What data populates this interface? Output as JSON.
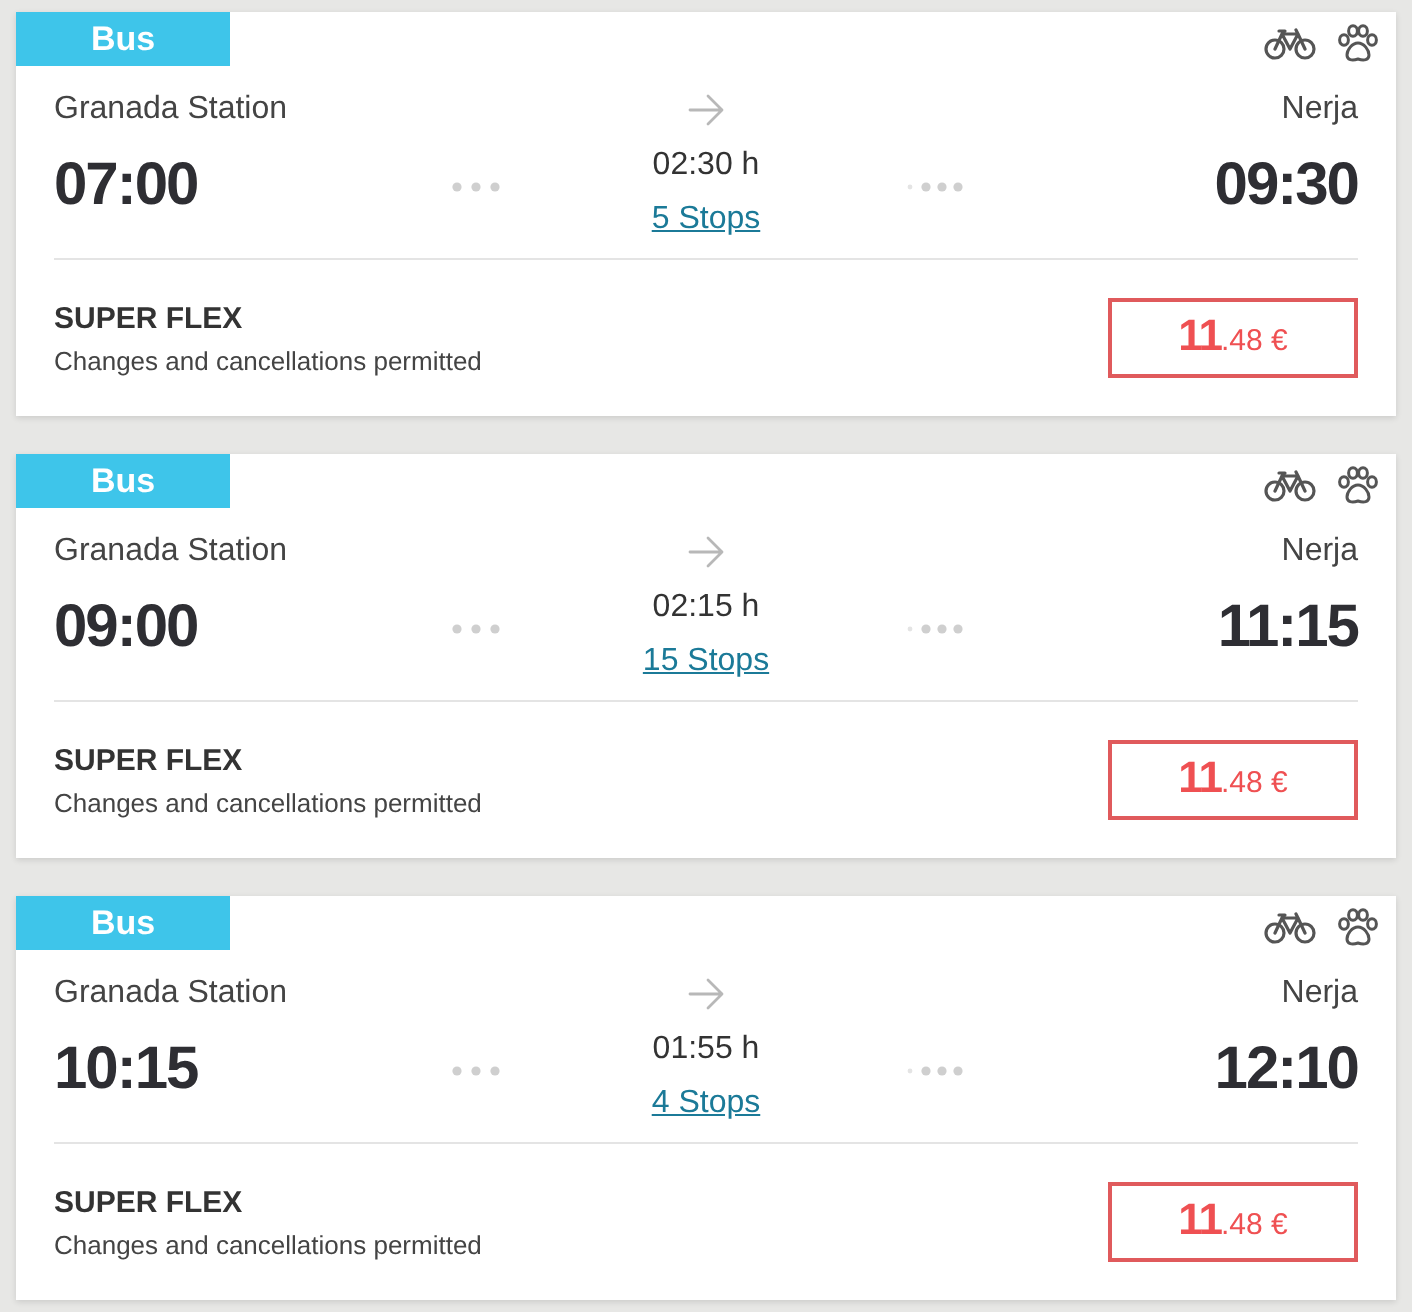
{
  "trips": [
    {
      "mode": "Bus",
      "origin": "Granada Station",
      "destination": "Nerja",
      "departure": "07:00",
      "arrival": "09:30",
      "duration": "02:30 h",
      "stops": "5 Stops",
      "fare": {
        "name": "SUPER FLEX",
        "description": "Changes and cancellations permitted",
        "price_integer": "11",
        "price_fraction": ".48 €"
      }
    },
    {
      "mode": "Bus",
      "origin": "Granada Station",
      "destination": "Nerja",
      "departure": "09:00",
      "arrival": "11:15",
      "duration": "02:15 h",
      "stops": "15 Stops",
      "fare": {
        "name": "SUPER FLEX",
        "description": "Changes and cancellations permitted",
        "price_integer": "11",
        "price_fraction": ".48 €"
      }
    },
    {
      "mode": "Bus",
      "origin": "Granada Station",
      "destination": "Nerja",
      "departure": "10:15",
      "arrival": "12:10",
      "duration": "01:55 h",
      "stops": "4 Stops",
      "fare": {
        "name": "SUPER FLEX",
        "description": "Changes and cancellations permitted",
        "price_integer": "11",
        "price_fraction": ".48 €"
      }
    }
  ]
}
